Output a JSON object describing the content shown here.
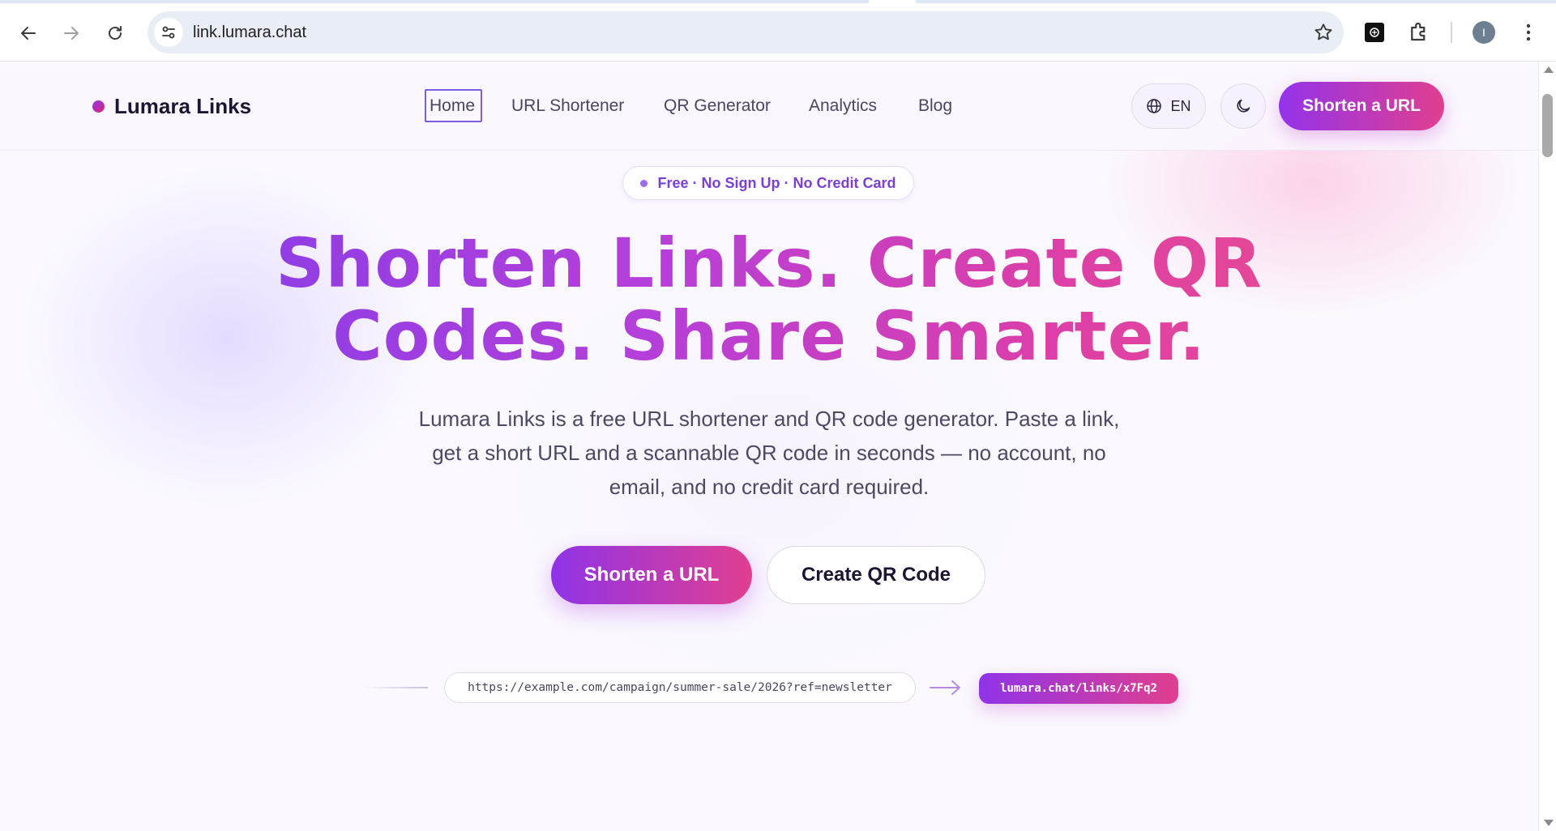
{
  "browser": {
    "url": "link.lumara.chat",
    "profile_initial": "I",
    "icons": {
      "back": "back-arrow-icon",
      "forward": "forward-arrow-icon",
      "reload": "reload-icon",
      "site_info": "tune-icon",
      "bookmark": "star-icon",
      "extension": "extension-puzzle-icon",
      "menu": "kebab-menu-icon"
    }
  },
  "header": {
    "logo_text": "Lumara Links",
    "nav": [
      {
        "label": "Home",
        "active": true
      },
      {
        "label": "URL Shortener"
      },
      {
        "label": "QR Generator"
      },
      {
        "label": "Analytics"
      },
      {
        "label": "Blog"
      }
    ],
    "language": "EN",
    "cta_label": "Shorten a URL"
  },
  "hero": {
    "badge": "Free · No Sign Up · No Credit Card",
    "title_line1": "Shorten Links. Create QR",
    "title_line2": "Codes. Share Smarter.",
    "subtitle": "Lumara Links is a free URL shortener and QR code generator. Paste a link, get a short URL and a scannable QR code in seconds — no account, no email, and no credit card required.",
    "primary_cta": "Shorten a URL",
    "secondary_cta": "Create QR Code"
  },
  "demo": {
    "long_url": "https://example.com/campaign/summer-sale/2026?ref=newsletter",
    "short_url": "lumara.chat/links/x7Fq2"
  },
  "colors": {
    "accent_purple": "#9333ea",
    "accent_pink": "#e13f8f",
    "text_dark": "#1d1533"
  }
}
